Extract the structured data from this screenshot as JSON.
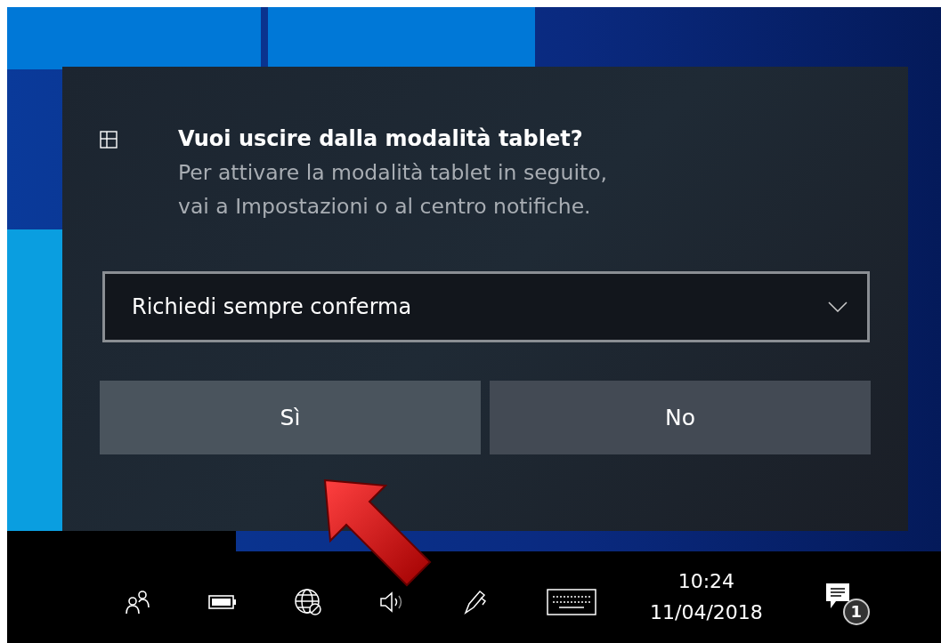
{
  "dialog": {
    "title": "Vuoi uscire dalla modalità tablet?",
    "message": [
      "Per attivare la modalità tablet in seguito,",
      "vai a Impostazioni o al centro notifiche."
    ],
    "dropdown": {
      "value": "Richiedi sempre conferma"
    },
    "buttons": [
      {
        "label": "Sì",
        "kind": "confirm"
      },
      {
        "label": "No",
        "kind": "cancel"
      }
    ]
  },
  "taskbar": {
    "tray_icons": [
      {
        "kind": "people"
      },
      {
        "kind": "battery"
      },
      {
        "kind": "network"
      },
      {
        "kind": "volume"
      },
      {
        "kind": "pen"
      },
      {
        "kind": "keyboard"
      }
    ],
    "clock": {
      "time": "10:24",
      "date": "11/04/2018"
    },
    "notifications": {
      "count": "1"
    }
  }
}
